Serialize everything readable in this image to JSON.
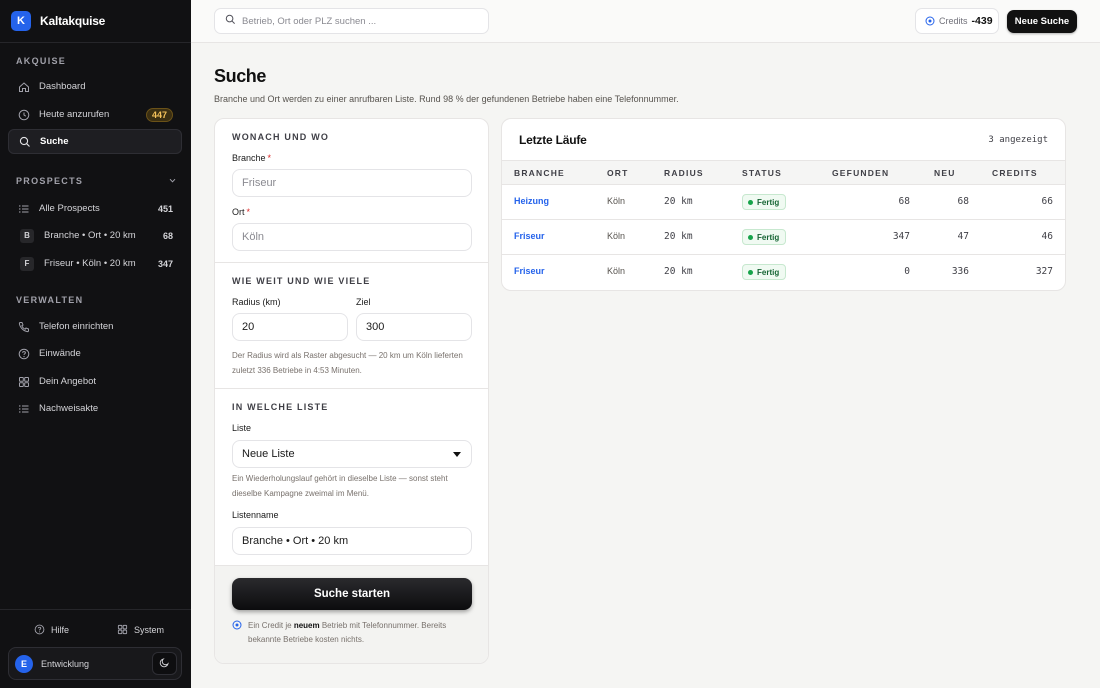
{
  "app": {
    "logo_letter": "K",
    "name": "Kaltakquise"
  },
  "sidebar": {
    "sections": {
      "akquise": "AKQUISE",
      "prospects": "PROSPECTS",
      "verwalten": "VERWALTEN"
    },
    "akquise_items": [
      {
        "label": "Dashboard",
        "icon": "home-icon"
      },
      {
        "label": "Heute anzurufen",
        "icon": "clock-icon",
        "badge": "447"
      },
      {
        "label": "Suche",
        "icon": "search-icon",
        "active": true
      }
    ],
    "prospect_items": [
      {
        "label": "Alle Prospects",
        "icon": "list-icon",
        "count": "451"
      },
      {
        "letter": "B",
        "label": "Branche • Ort • 20 km",
        "count": "68"
      },
      {
        "letter": "F",
        "label": "Friseur • Köln • 20 km",
        "count": "347"
      }
    ],
    "verwalten_items": [
      {
        "label": "Telefon einrichten",
        "icon": "phone-icon"
      },
      {
        "label": "Einwände",
        "icon": "help-circle-icon"
      },
      {
        "label": "Dein Angebot",
        "icon": "grid-icon"
      },
      {
        "label": "Nachweisakte",
        "icon": "list-icon"
      }
    ],
    "footer": {
      "help": "Hilfe",
      "system": "System"
    },
    "user": {
      "initial": "E",
      "name": "Entwicklung"
    }
  },
  "topbar": {
    "search_placeholder": "Betrieb, Ort oder PLZ suchen ...",
    "credits_label": "Credits",
    "credits_value": "-439",
    "new_search": "Neue Suche"
  },
  "page": {
    "title": "Suche",
    "subtitle": "Branche und Ort werden zu einer anrufbaren Liste. Rund 98 % der gefundenen Betriebe haben eine Telefonnummer."
  },
  "form": {
    "section1": {
      "title": "WONACH UND WO",
      "branche_label": "Branche",
      "branche_placeholder": "Friseur",
      "ort_label": "Ort",
      "ort_placeholder": "Köln",
      "required_mark": "*"
    },
    "section2": {
      "title": "WIE WEIT UND WIE VIELE",
      "radius_label": "Radius (km)",
      "radius_value": "20",
      "ziel_label": "Ziel",
      "ziel_value": "300",
      "hint": "Der Radius wird als Raster abgesucht — 20 km um Köln lieferten zuletzt 336 Betriebe in 4:53 Minuten."
    },
    "section3": {
      "title": "IN WELCHE LISTE",
      "liste_label": "Liste",
      "liste_value": "Neue Liste",
      "liste_hint": "Ein Wiederholungslauf gehört in dieselbe Liste — sonst steht dieselbe Kampagne zweimal im Menü.",
      "listenname_label": "Listenname",
      "listenname_value": "Branche • Ort • 20 km"
    },
    "submit": "Suche starten",
    "note_pre": "Ein Credit je",
    "note_bold": "neuem",
    "note_post": "Betrieb mit Telefonnummer. Bereits bekannte Betriebe kosten nichts."
  },
  "runs": {
    "title": "Letzte Läufe",
    "count_text": "3 angezeigt",
    "columns": [
      "BRANCHE",
      "ORT",
      "RADIUS",
      "STATUS",
      "GEFUNDEN",
      "NEU",
      "CREDITS"
    ],
    "rows": [
      {
        "branche": "Heizung",
        "ort": "Köln",
        "radius": "20 km",
        "status": "Fertig",
        "gefunden": "68",
        "neu": "68",
        "credits": "66"
      },
      {
        "branche": "Friseur",
        "ort": "Köln",
        "radius": "20 km",
        "status": "Fertig",
        "gefunden": "347",
        "neu": "47",
        "credits": "46"
      },
      {
        "branche": "Friseur",
        "ort": "Köln",
        "radius": "20 km",
        "status": "Fertig",
        "gefunden": "0",
        "neu": "336",
        "credits": "327"
      }
    ]
  },
  "colors": {
    "accent": "#2563eb",
    "sidebar_bg": "#111113",
    "badge": "#f4c25b",
    "status_green": "#16a34a"
  }
}
